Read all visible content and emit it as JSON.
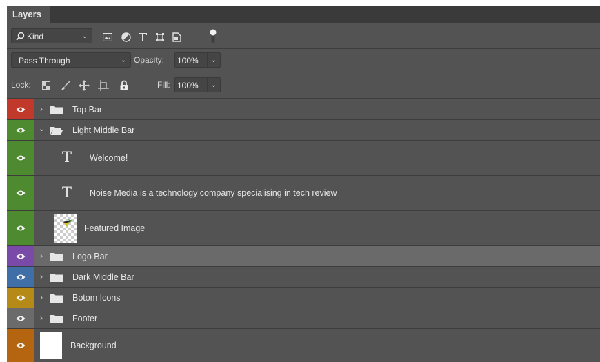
{
  "panel": {
    "tab_label": "Layers"
  },
  "filter": {
    "kind_label": "Kind"
  },
  "blend": {
    "mode": "Pass Through",
    "opacity_label": "Opacity:",
    "opacity_value": "100%"
  },
  "lock": {
    "lock_label": "Lock:",
    "fill_label": "Fill:",
    "fill_value": "100%"
  },
  "layers": [
    {
      "name": "Top Bar",
      "type": "group",
      "expanded": false,
      "tag_color": "#c0392b"
    },
    {
      "name": "Light Middle Bar",
      "type": "group",
      "expanded": true,
      "tag_color": "#4e8a2f"
    },
    {
      "name": "Welcome!",
      "type": "text",
      "tag_color": "#4e8a2f"
    },
    {
      "name": "Noise Media is a technology company specialising in tech review",
      "type": "text",
      "tag_color": "#4e8a2f"
    },
    {
      "name": "Featured Image",
      "type": "image",
      "tag_color": "#4e8a2f"
    },
    {
      "name": "Logo Bar",
      "type": "group",
      "expanded": false,
      "tag_color": "#7a4aa8",
      "selected": true
    },
    {
      "name": "Dark Middle Bar",
      "type": "group",
      "expanded": false,
      "tag_color": "#3f6fa6"
    },
    {
      "name": "Botom Icons",
      "type": "group",
      "expanded": false,
      "tag_color": "#b58a16"
    },
    {
      "name": "Footer",
      "type": "group",
      "expanded": false,
      "tag_color": "#6b6b6b"
    },
    {
      "name": "Background",
      "type": "image",
      "tag_color": "#b5650f"
    }
  ],
  "colors": {
    "panel_bg": "#535353",
    "selected_row": "#6a6a6a",
    "divider": "#3d3d3d"
  }
}
